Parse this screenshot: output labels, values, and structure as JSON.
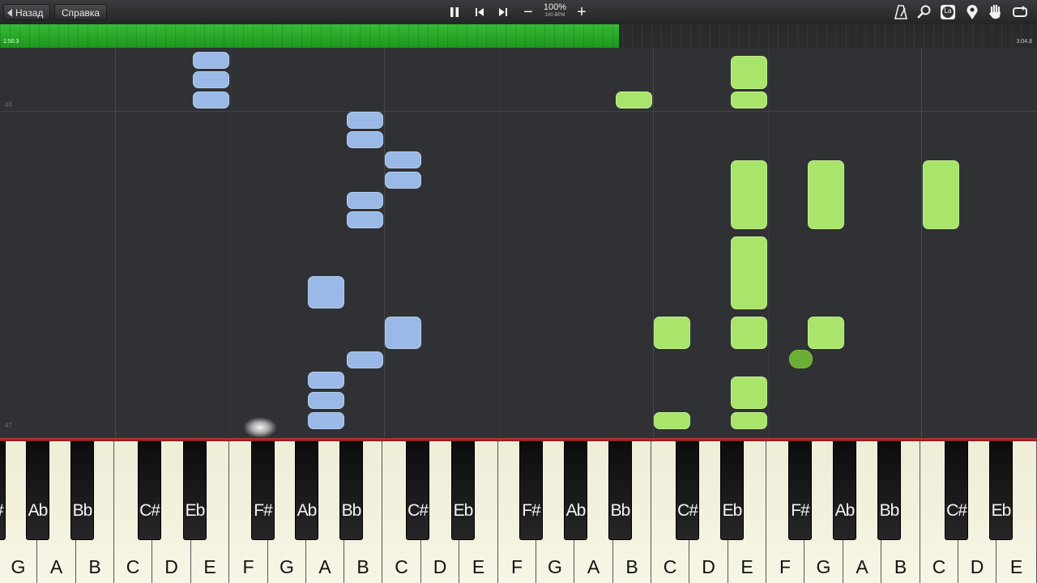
{
  "nav": {
    "back_label": "Назад",
    "help_label": "Справка"
  },
  "playback": {
    "pause_icon": "pause-icon",
    "prev_icon": "skip-back-icon",
    "next_icon": "skip-forward-icon",
    "speed_percent": "100%",
    "bpm_label": "100 BPM",
    "minus_label": "−",
    "plus_label": "+"
  },
  "toolbar_icons": [
    "metronome-icon",
    "search-icon",
    "note-label-icon",
    "marker-icon",
    "hand-icon",
    "loop-icon"
  ],
  "note_label_text": "La",
  "timeline": {
    "current_time": "1:50.3",
    "total_time": "3:04.8",
    "progress": 0.597
  },
  "roll": {
    "row_labels": [
      "48",
      "47"
    ]
  },
  "colors": {
    "left_hand": "#9ab9e6",
    "right_hand": "#a9e46b",
    "progress": "#2ab52a",
    "red_line": "#b03030"
  },
  "keyboard": {
    "white_keys": [
      "G",
      "A",
      "B",
      "C",
      "D",
      "E",
      "F",
      "G",
      "A",
      "B",
      "C",
      "D",
      "E",
      "F",
      "G",
      "A",
      "B",
      "C",
      "D",
      "E",
      "F",
      "G",
      "A",
      "B",
      "C",
      "D",
      "E"
    ],
    "black_keys": [
      "F#",
      "Ab",
      "Bb",
      "C#",
      "Eb",
      "F#",
      "Ab",
      "Bb",
      "C#",
      "Eb",
      "F#",
      "Ab",
      "Bb",
      "C#",
      "Eb",
      "F#",
      "Ab",
      "Bb",
      "C#",
      "Eb"
    ]
  }
}
